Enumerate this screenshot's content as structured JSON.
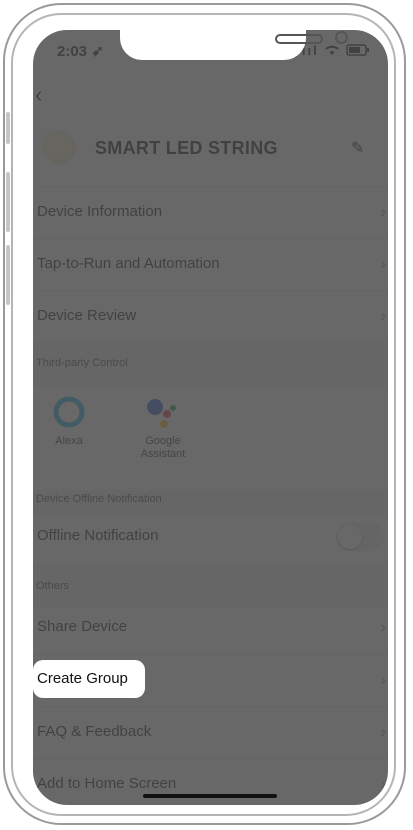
{
  "status": {
    "time": "2:03",
    "signal": "ııl",
    "wifi": "wifi",
    "battery": "battery"
  },
  "header": {
    "back_icon": "‹",
    "device_name": "SMART LED STRING",
    "edit_icon": "✎"
  },
  "menu": {
    "device_information": "Device Information",
    "tap_to_run": "Tap-to-Run and Automation",
    "device_review": "Device Review",
    "offline_notification": "Offline Notification",
    "share_device": "Share Device",
    "create_group": "Create Group",
    "faq_feedback": "FAQ & Feedback",
    "add_home_screen": "Add to Home Screen"
  },
  "sections": {
    "third_party": "Third-party Control",
    "offline": "Device Offline Notification",
    "others": "Others"
  },
  "third_party": {
    "alexa": "Alexa",
    "google_line1": "Google",
    "google_line2": "Assistant"
  },
  "toggle": {
    "offline_notification_on": false
  },
  "colors": {
    "alexa_ring": "#19b0de",
    "google_blue": "#2a5ad8",
    "google_red": "#e53935",
    "google_yellow": "#f8bf18",
    "google_green": "#1ea35a",
    "overlay": "#4b4b4b"
  }
}
